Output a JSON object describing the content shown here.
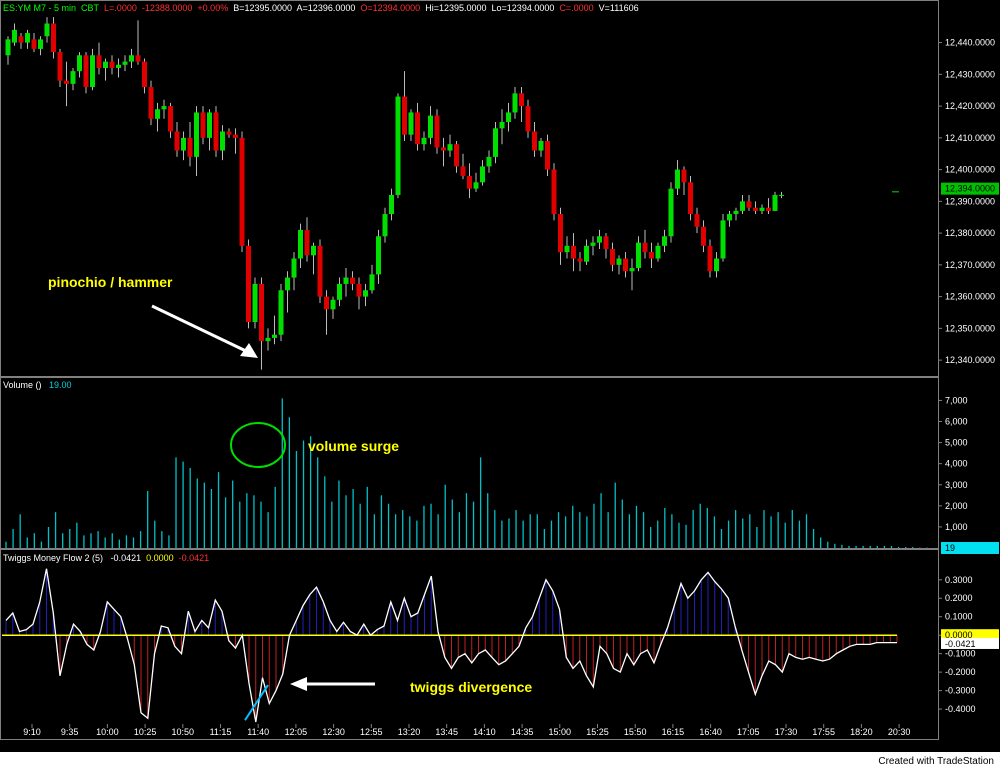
{
  "header": {
    "symbol": "ES:YM M7 - 5 min",
    "exchange": "CBT",
    "last": "L=.0000",
    "change": "-12388.0000",
    "pct": "+0.00%",
    "bid": "B=12395.0000",
    "ask": "A=12396.0000",
    "open": "O=12394.0000",
    "high": "Hi=12395.0000",
    "low": "Lo=12394.0000",
    "close": "C=.0000",
    "volume": "V=111606"
  },
  "volume_header": {
    "label": "Volume  ()",
    "value": "19.00"
  },
  "twiggs_header": {
    "label": "Twiggs Money Flow 2  (5)",
    "v1": "-0.0421",
    "v2": "0.0000",
    "v3": "-0.0421"
  },
  "colors": {
    "up": "#00e000",
    "down": "#e00000",
    "volume": "#00c0c8",
    "tmf_line": "#ffffff",
    "tmf_pos": "#2020c0",
    "tmf_neg": "#c02020",
    "zero_line": "#ffff00",
    "annotation": "#ffff00",
    "circle": "#00dd00",
    "div_line": "#00bfff"
  },
  "annotations": {
    "hammer": "pinochio / hammer",
    "volume": "volume surge",
    "twiggs": "twiggs divergence"
  },
  "credit": "Created with TradeStation",
  "chart_data": [
    {
      "type": "candlestick",
      "x": [
        "9:10",
        "9:35",
        "10:00",
        "10:25",
        "10:50",
        "11:15",
        "11:40",
        "12:05",
        "12:30",
        "12:55",
        "13:20",
        "13:45",
        "14:10",
        "14:35",
        "15:00",
        "15:25",
        "15:50",
        "16:15",
        "16:40",
        "17:05",
        "17:30",
        "17:55",
        "18:20",
        "20:30"
      ],
      "last_price_label": "12,394.0000",
      "y_ticks": [
        "12,340.0000",
        "12,350.0000",
        "12,360.0000",
        "12,370.0000",
        "12,380.0000",
        "12,390.0000",
        "12,400.0000",
        "12,410.0000",
        "12,420.0000",
        "12,430.0000",
        "12,440.0000"
      ],
      "ylim": [
        12335,
        12449
      ],
      "ohlc": [
        [
          12436,
          12442,
          12433,
          12441
        ],
        [
          12440,
          12446,
          12439,
          12444
        ],
        [
          12442,
          12443,
          12438,
          12440
        ],
        [
          12440,
          12444,
          12438,
          12443
        ],
        [
          12441,
          12443,
          12437,
          12438
        ],
        [
          12438,
          12442,
          12436,
          12441
        ],
        [
          12442,
          12448,
          12440,
          12446
        ],
        [
          12446,
          12448,
          12435,
          12437
        ],
        [
          12437,
          12438,
          12426,
          12428
        ],
        [
          12428,
          12434,
          12420,
          12427
        ],
        [
          12427,
          12432,
          12425,
          12431
        ],
        [
          12431,
          12437,
          12429,
          12436
        ],
        [
          12436,
          12437,
          12424,
          12426
        ],
        [
          12426,
          12438,
          12425,
          12436
        ],
        [
          12436,
          12440,
          12430,
          12432
        ],
        [
          12432,
          12435,
          12428,
          12434
        ],
        [
          12434,
          12436,
          12430,
          12432
        ],
        [
          12432,
          12435,
          12429,
          12433
        ],
        [
          12433,
          12436,
          12431,
          12434
        ],
        [
          12434,
          12438,
          12432,
          12436
        ],
        [
          12436,
          12447,
          12433,
          12434
        ],
        [
          12434,
          12435,
          12424,
          12426
        ],
        [
          12426,
          12428,
          12414,
          12416
        ],
        [
          12416,
          12421,
          12412,
          12419
        ],
        [
          12419,
          12422,
          12416,
          12420
        ],
        [
          12420,
          12421,
          12410,
          12412
        ],
        [
          12412,
          12415,
          12404,
          12406
        ],
        [
          12406,
          12412,
          12403,
          12410
        ],
        [
          12410,
          12415,
          12401,
          12404
        ],
        [
          12404,
          12420,
          12398,
          12418
        ],
        [
          12418,
          12420,
          12408,
          12410
        ],
        [
          12410,
          12419,
          12406,
          12418
        ],
        [
          12418,
          12420,
          12404,
          12406
        ],
        [
          12406,
          12414,
          12403,
          12412
        ],
        [
          12412,
          12413,
          12410,
          12411
        ],
        [
          12411,
          12413,
          12405,
          12410
        ],
        [
          12410,
          12412,
          12374,
          12376
        ],
        [
          12376,
          12378,
          12350,
          12352
        ],
        [
          12352,
          12366,
          12350,
          12364
        ],
        [
          12364,
          12366,
          12337,
          12346
        ],
        [
          12346,
          12350,
          12343,
          12347
        ],
        [
          12347,
          12354,
          12345,
          12348
        ],
        [
          12348,
          12364,
          12346,
          12362
        ],
        [
          12362,
          12368,
          12355,
          12366
        ],
        [
          12366,
          12374,
          12362,
          12372
        ],
        [
          12372,
          12383,
          12369,
          12381
        ],
        [
          12381,
          12385,
          12371,
          12373
        ],
        [
          12373,
          12377,
          12367,
          12376
        ],
        [
          12376,
          12378,
          12358,
          12360
        ],
        [
          12360,
          12362,
          12348,
          12356
        ],
        [
          12356,
          12360,
          12353,
          12359
        ],
        [
          12359,
          12366,
          12357,
          12364
        ],
        [
          12364,
          12369,
          12360,
          12366
        ],
        [
          12366,
          12368,
          12362,
          12364
        ],
        [
          12364,
          12366,
          12356,
          12360
        ],
        [
          12360,
          12364,
          12357,
          12362
        ],
        [
          12362,
          12370,
          12361,
          12367
        ],
        [
          12367,
          12381,
          12364,
          12379
        ],
        [
          12379,
          12388,
          12377,
          12386
        ],
        [
          12386,
          12394,
          12384,
          12392
        ],
        [
          12392,
          12424,
          12391,
          12423
        ],
        [
          12423,
          12431,
          12409,
          12411
        ],
        [
          12411,
          12419,
          12409,
          12418
        ],
        [
          12418,
          12421,
          12406,
          12408
        ],
        [
          12408,
          12412,
          12406,
          12410
        ],
        [
          12410,
          12420,
          12408,
          12417
        ],
        [
          12417,
          12419,
          12405,
          12407
        ],
        [
          12407,
          12410,
          12401,
          12406
        ],
        [
          12406,
          12411,
          12404,
          12408
        ],
        [
          12408,
          12409,
          12399,
          12401
        ],
        [
          12401,
          12405,
          12397,
          12398
        ],
        [
          12398,
          12402,
          12391,
          12394
        ],
        [
          12394,
          12399,
          12393,
          12396
        ],
        [
          12396,
          12403,
          12395,
          12401
        ],
        [
          12401,
          12406,
          12399,
          12404
        ],
        [
          12404,
          12415,
          12402,
          12413
        ],
        [
          12413,
          12419,
          12408,
          12415
        ],
        [
          12415,
          12421,
          12412,
          12418
        ],
        [
          12418,
          12426,
          12416,
          12424
        ],
        [
          12424,
          12426,
          12415,
          12420
        ],
        [
          12420,
          12422,
          12410,
          12412
        ],
        [
          12412,
          12415,
          12404,
          12406
        ],
        [
          12406,
          12410,
          12404,
          12409
        ],
        [
          12409,
          12411,
          12398,
          12400
        ],
        [
          12400,
          12402,
          12384,
          12386
        ],
        [
          12386,
          12388,
          12370,
          12374
        ],
        [
          12374,
          12379,
          12372,
          12376
        ],
        [
          12376,
          12380,
          12368,
          12372
        ],
        [
          12372,
          12374,
          12368,
          12371
        ],
        [
          12371,
          12378,
          12370,
          12376
        ],
        [
          12376,
          12379,
          12373,
          12377
        ],
        [
          12377,
          12381,
          12375,
          12379
        ],
        [
          12379,
          12380,
          12372,
          12375
        ],
        [
          12375,
          12377,
          12368,
          12370
        ],
        [
          12370,
          12373,
          12367,
          12372
        ],
        [
          12372,
          12374,
          12366,
          12368
        ],
        [
          12368,
          12372,
          12362,
          12369
        ],
        [
          12369,
          12379,
          12368,
          12377
        ],
        [
          12377,
          12381,
          12372,
          12374
        ],
        [
          12374,
          12377,
          12369,
          12372
        ],
        [
          12372,
          12377,
          12371,
          12376
        ],
        [
          12376,
          12381,
          12374,
          12379
        ],
        [
          12379,
          12396,
          12377,
          12394
        ],
        [
          12394,
          12403,
          12392,
          12400
        ],
        [
          12400,
          12401,
          12392,
          12396
        ],
        [
          12396,
          12398,
          12384,
          12386
        ],
        [
          12386,
          12388,
          12380,
          12382
        ],
        [
          12382,
          12384,
          12374,
          12376
        ],
        [
          12376,
          12378,
          12366,
          12368
        ],
        [
          12368,
          12374,
          12366,
          12372
        ],
        [
          12372,
          12386,
          12371,
          12384
        ],
        [
          12384,
          12387,
          12382,
          12386
        ],
        [
          12386,
          12388,
          12384,
          12387
        ],
        [
          12387,
          12392,
          12386,
          12390
        ],
        [
          12390,
          12392,
          12387,
          12388
        ],
        [
          12388,
          12390,
          12386,
          12387
        ],
        [
          12387,
          12389,
          12386,
          12388
        ],
        [
          12388,
          12391,
          12386,
          12387
        ],
        [
          12387,
          12393,
          12387,
          12392
        ],
        [
          12392,
          12393,
          12391,
          12392
        ]
      ]
    },
    {
      "type": "bar",
      "name": "Volume",
      "y_ticks": [
        "1,000",
        "2,000",
        "3,000",
        "4,000",
        "5,000",
        "6,000",
        "7,000"
      ],
      "ylim": [
        0,
        7400
      ],
      "last_value_label": "19",
      "values": [
        300,
        900,
        1600,
        500,
        700,
        300,
        1000,
        1700,
        700,
        900,
        1200,
        600,
        700,
        800,
        500,
        700,
        400,
        600,
        500,
        800,
        2700,
        1300,
        800,
        600,
        4300,
        4100,
        3800,
        3300,
        3100,
        2800,
        3600,
        2400,
        3200,
        2200,
        2600,
        2500,
        2200,
        1700,
        2900,
        7100,
        6200,
        4600,
        5100,
        5300,
        4300,
        3400,
        2200,
        3200,
        2500,
        2800,
        2100,
        2900,
        1600,
        2500,
        2100,
        1600,
        1800,
        1500,
        1300,
        2000,
        2100,
        1600,
        3000,
        2300,
        1700,
        2600,
        2200,
        4300,
        2600,
        1800,
        1300,
        1400,
        1800,
        1300,
        1600,
        1600,
        900,
        1300,
        1700,
        1500,
        2000,
        1700,
        1500,
        2100,
        2600,
        1700,
        3100,
        2300,
        1600,
        2000,
        1700,
        1000,
        1300,
        1900,
        1600,
        1200,
        1100,
        1800,
        2100,
        1900,
        1500,
        900,
        1300,
        1800,
        1400,
        1600,
        1000,
        1800,
        1500,
        1700,
        1200,
        1800,
        1300,
        1600,
        900,
        500,
        300,
        200,
        150,
        100,
        100,
        100,
        100,
        100,
        100,
        100,
        50,
        50,
        50,
        20,
        19
      ]
    },
    {
      "type": "line",
      "name": "Twiggs Money Flow 2",
      "y_ticks": [
        "-0.4000",
        "-0.3000",
        "-0.2000",
        "-0.1000",
        "0.0000",
        "0.1000",
        "0.2000",
        "0.3000"
      ],
      "ylim": [
        -0.47,
        0.38
      ],
      "last_value_label": "-0.0421",
      "zero_label": "0.0000",
      "values": [
        0.08,
        0.12,
        0.02,
        0.03,
        0.06,
        0.18,
        0.36,
        0.12,
        -0.22,
        -0.05,
        0.06,
        0.02,
        -0.05,
        -0.08,
        0.02,
        0.18,
        0.14,
        0.1,
        -0.02,
        -0.16,
        -0.42,
        -0.45,
        -0.1,
        0.05,
        0.04,
        -0.06,
        -0.1,
        0.13,
        0.02,
        0.08,
        0.04,
        0.19,
        0.13,
        -0.03,
        -0.07,
        0.0,
        -0.26,
        -0.47,
        -0.23,
        -0.37,
        -0.3,
        -0.21,
        0.0,
        0.08,
        0.16,
        0.22,
        0.26,
        0.18,
        0.08,
        0.02,
        0.07,
        0.02,
        0.0,
        0.06,
        0.0,
        0.03,
        0.05,
        0.18,
        0.08,
        0.2,
        0.1,
        0.12,
        0.22,
        0.32,
        0.02,
        -0.12,
        -0.18,
        -0.12,
        -0.1,
        -0.15,
        -0.1,
        -0.08,
        -0.12,
        -0.16,
        -0.14,
        -0.1,
        -0.06,
        0.04,
        0.1,
        0.2,
        0.3,
        0.24,
        0.14,
        -0.12,
        -0.18,
        -0.14,
        -0.22,
        -0.28,
        -0.06,
        -0.1,
        -0.18,
        -0.2,
        -0.1,
        -0.16,
        -0.1,
        -0.08,
        -0.15,
        -0.05,
        0.04,
        0.16,
        0.28,
        0.2,
        0.24,
        0.3,
        0.34,
        0.29,
        0.25,
        0.2,
        0.05,
        -0.08,
        -0.2,
        -0.32,
        -0.22,
        -0.14,
        -0.16,
        -0.2,
        -0.1,
        -0.12,
        -0.13,
        -0.12,
        -0.13,
        -0.14,
        -0.13,
        -0.1,
        -0.08,
        -0.06,
        -0.05,
        -0.05,
        -0.05,
        -0.04,
        -0.04,
        -0.04,
        -0.04
      ]
    }
  ]
}
